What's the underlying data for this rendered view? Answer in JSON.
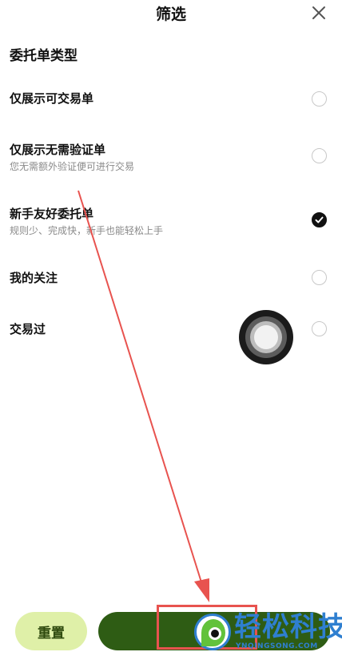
{
  "header": {
    "title": "筛选",
    "close_icon": "close-icon"
  },
  "section": {
    "title": "委托单类型"
  },
  "options": [
    {
      "label": "仅展示可交易单",
      "sub": "",
      "checked": false
    },
    {
      "label": "仅展示无需验证单",
      "sub": "您无需额外验证便可进行交易",
      "checked": false
    },
    {
      "label": "新手友好委托单",
      "sub": "规则少、完成快，新手也能轻松上手",
      "checked": true
    },
    {
      "label": "我的关注",
      "sub": "",
      "checked": false
    },
    {
      "label": "交易过",
      "sub": "",
      "checked": false
    }
  ],
  "footer": {
    "reset_label": "重置",
    "confirm_label": ""
  },
  "watermark": {
    "text": "轻松科技",
    "domain": "YNQINGSONG.COM"
  },
  "colors": {
    "reset_bg": "#dff0a8",
    "confirm_bg": "#2e5c14",
    "annotation": "#e8534f",
    "watermark": "#2f7fd0"
  }
}
